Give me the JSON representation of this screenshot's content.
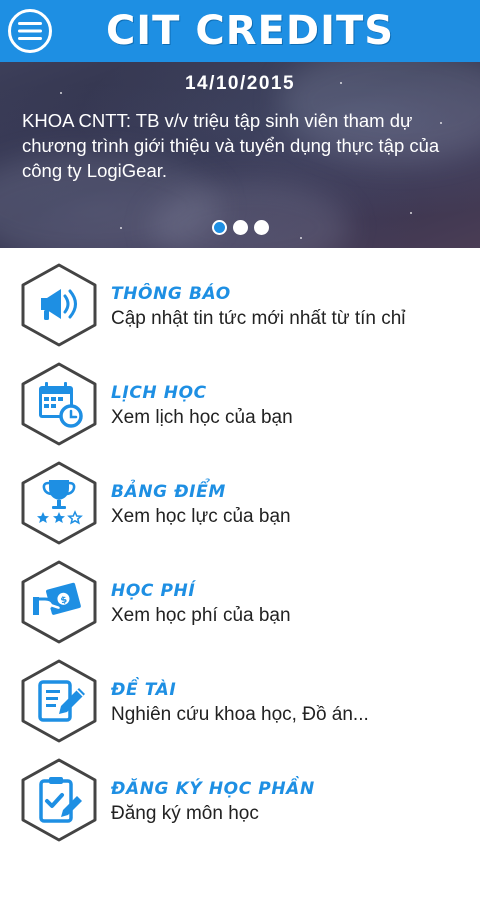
{
  "header": {
    "title": "CIT CREDITS",
    "menu_icon": "hamburger-menu-icon"
  },
  "banner": {
    "date": "14/10/2015",
    "text": "KHOA CNTT: TB v/v triệu tập sinh viên tham dự chương trình giới thiệu và tuyển dụng thực tập của công ty LogiGear.",
    "slide_count": 3,
    "active_slide": 1
  },
  "menu": {
    "items": [
      {
        "title": "THÔNG BÁO",
        "subtitle": "Cập nhật tin tức mới nhất từ tín chỉ",
        "icon": "megaphone-icon"
      },
      {
        "title": "LỊCH HỌC",
        "subtitle": "Xem lịch học của bạn",
        "icon": "calendar-clock-icon"
      },
      {
        "title": "BẢNG ĐIỂM",
        "subtitle": "Xem học lực của bạn",
        "icon": "trophy-stars-icon"
      },
      {
        "title": "HỌC PHÍ",
        "subtitle": "Xem học phí của bạn",
        "icon": "money-hand-icon"
      },
      {
        "title": "ĐỀ TÀI",
        "subtitle": "Nghiên cứu khoa học, Đồ án...",
        "icon": "document-pen-icon"
      },
      {
        "title": "ĐĂNG KÝ HỌC PHẦN",
        "subtitle": "Đăng ký môn học",
        "icon": "clipboard-check-icon"
      }
    ]
  },
  "colors": {
    "primary": "#1e8fe3",
    "text": "#222222",
    "hex_border": "#444444"
  }
}
